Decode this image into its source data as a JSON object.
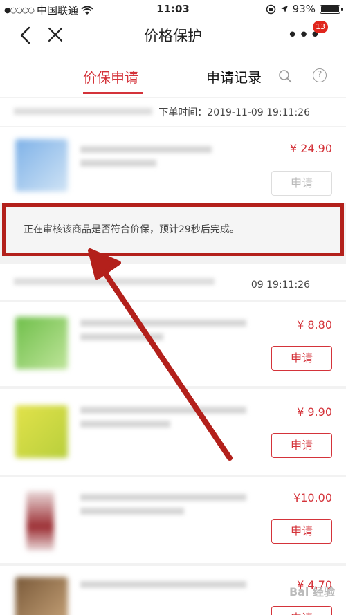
{
  "status_bar": {
    "carrier": "中国联通",
    "time": "11:03",
    "battery_percent": "93%",
    "battery_level": 0.93
  },
  "navbar": {
    "title": "价格保护",
    "badge_count": "13"
  },
  "tabs": [
    {
      "label": "价保申请",
      "active": true
    },
    {
      "label": "申请记录",
      "active": false
    }
  ],
  "orders": [
    {
      "time_label": "下单时间：2019-11-09 19:11:26",
      "items": [
        {
          "price": "¥ 24.90",
          "button": "申请",
          "disabled": true
        }
      ]
    },
    {
      "time_label": "09 19:11:26",
      "items": [
        {
          "price": "¥ 8.80",
          "button": "申请",
          "disabled": false
        },
        {
          "price": "¥ 9.90",
          "button": "申请",
          "disabled": false
        },
        {
          "price": "¥10.00",
          "button": "申请",
          "disabled": false
        },
        {
          "price": "¥ 4.70",
          "button": "申请",
          "disabled": false
        }
      ]
    }
  ],
  "notice": {
    "text": "正在审核该商品是否符合价保，预计29秒后完成。"
  },
  "watermark": "Bai 经验",
  "colors": {
    "accent": "#d4333a",
    "annotation": "#b3201b"
  }
}
